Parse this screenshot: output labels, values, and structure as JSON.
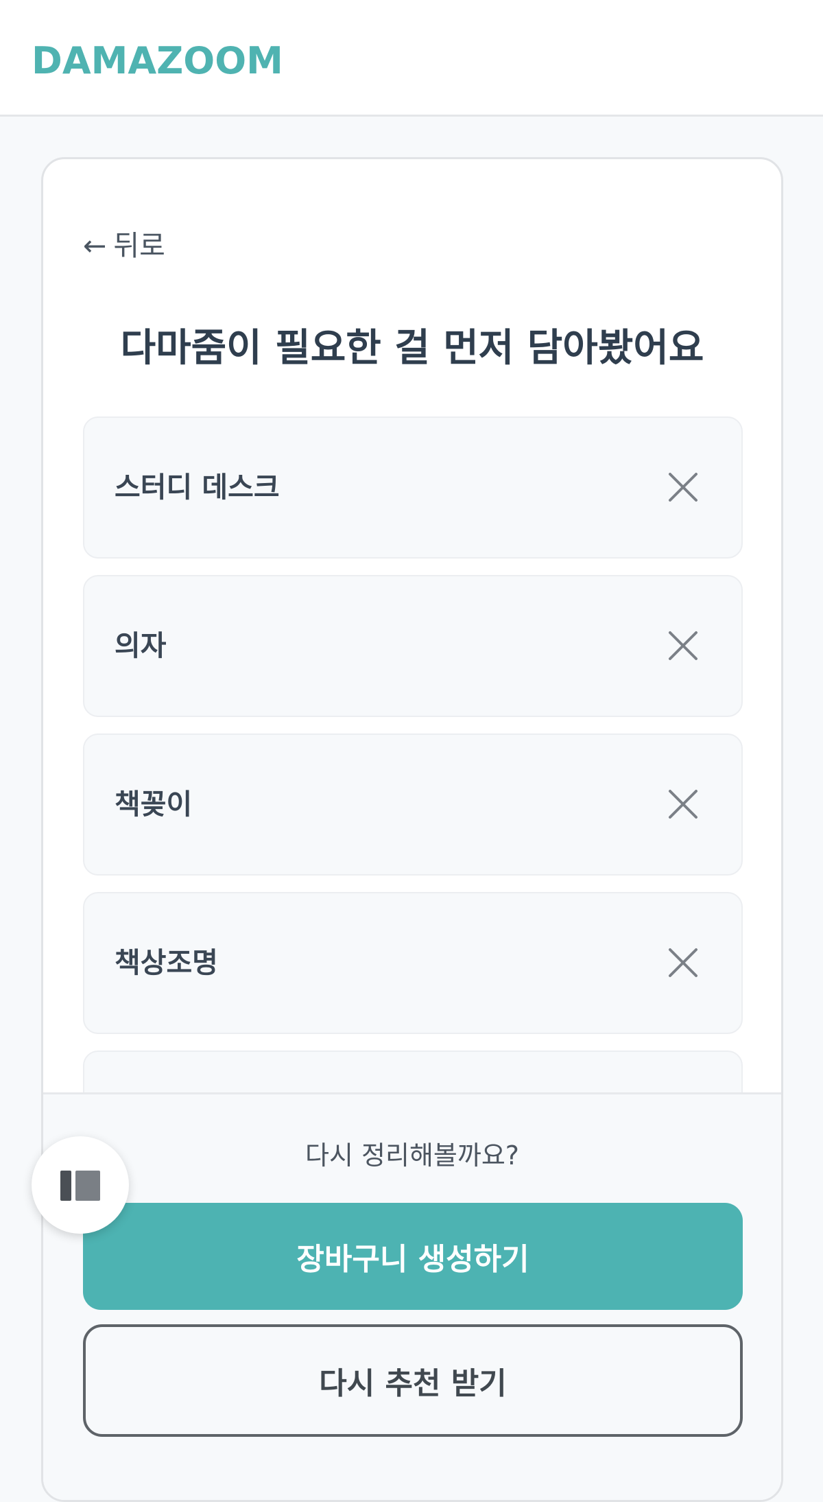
{
  "header": {
    "logo": "DAMAZOOM"
  },
  "card": {
    "back_arrow": "←",
    "back_label": "뒤로",
    "title": "다마줌이 필요한 걸 먼저 담아봤어요",
    "items": [
      {
        "label": "스터디 데스크"
      },
      {
        "label": "의자"
      },
      {
        "label": "책꽂이"
      },
      {
        "label": "책상조명"
      },
      {
        "label": ""
      }
    ],
    "remove_icon": "close-icon"
  },
  "bottom": {
    "prompt": "다시 정리해볼까요?",
    "primary_label": "장바구니 생성하기",
    "secondary_label": "다시 추천 받기"
  },
  "fab": {
    "icon": "sidebar-panel-icon"
  },
  "colors": {
    "accent": "#4db3b2",
    "logo": "#4fb3b1",
    "title": "#2f3e4e",
    "background": "#f7f9fb"
  }
}
